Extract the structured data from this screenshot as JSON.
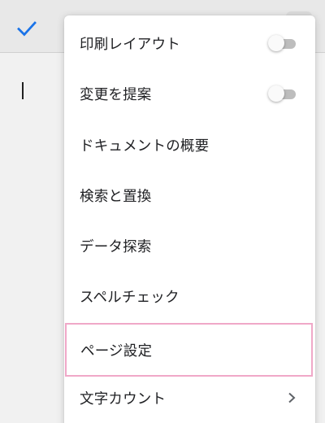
{
  "colors": {
    "accent": "#1a73e8",
    "highlight_border": "#f0a8c8",
    "toggle_track": "#bdbdbd",
    "text": "#202124"
  },
  "toolbar": {
    "confirm_icon": "check-icon"
  },
  "menu": {
    "items": [
      {
        "label": "印刷レイアウト",
        "control": "toggle",
        "checked": false
      },
      {
        "label": "変更を提案",
        "control": "toggle",
        "checked": false
      },
      {
        "label": "ドキュメントの概要"
      },
      {
        "label": "検索と置換"
      },
      {
        "label": "データ探索"
      },
      {
        "label": "スペルチェック"
      },
      {
        "label": "ページ設定",
        "highlighted": true
      },
      {
        "label": "文字カウント",
        "control": "chevron-right-icon"
      }
    ]
  }
}
